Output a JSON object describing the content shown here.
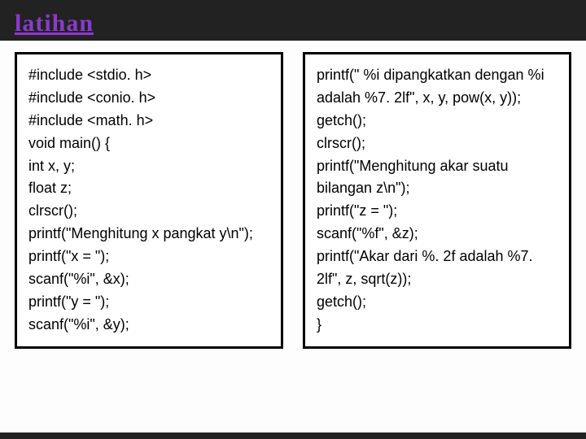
{
  "header": {
    "title": "latihan"
  },
  "left": {
    "lines": [
      "#include <stdio. h>",
      "#include <conio. h>",
      "#include <math. h>",
      "void main() {",
      " int x, y;",
      "float z;",
      "clrscr();",
      "printf(\"Menghitung x pangkat y\\n\");",
      "printf(\"x = \");",
      "scanf(\"%i\", &x);",
      "printf(\"y = \");",
      "scanf(\"%i\", &y);"
    ]
  },
  "right": {
    "lines": [
      "printf(\" %i dipangkatkan dengan %i adalah %7. 2lf\", x, y, pow(x, y));",
      "getch();",
      "clrscr();",
      "printf(\"Menghitung akar suatu bilangan z\\n\");",
      "printf(\"z = \");",
      "scanf(\"%f\", &z);",
      "printf(\"Akar dari %. 2f adalah %7. 2lf\", z, sqrt(z));",
      "getch();",
      "}"
    ]
  }
}
